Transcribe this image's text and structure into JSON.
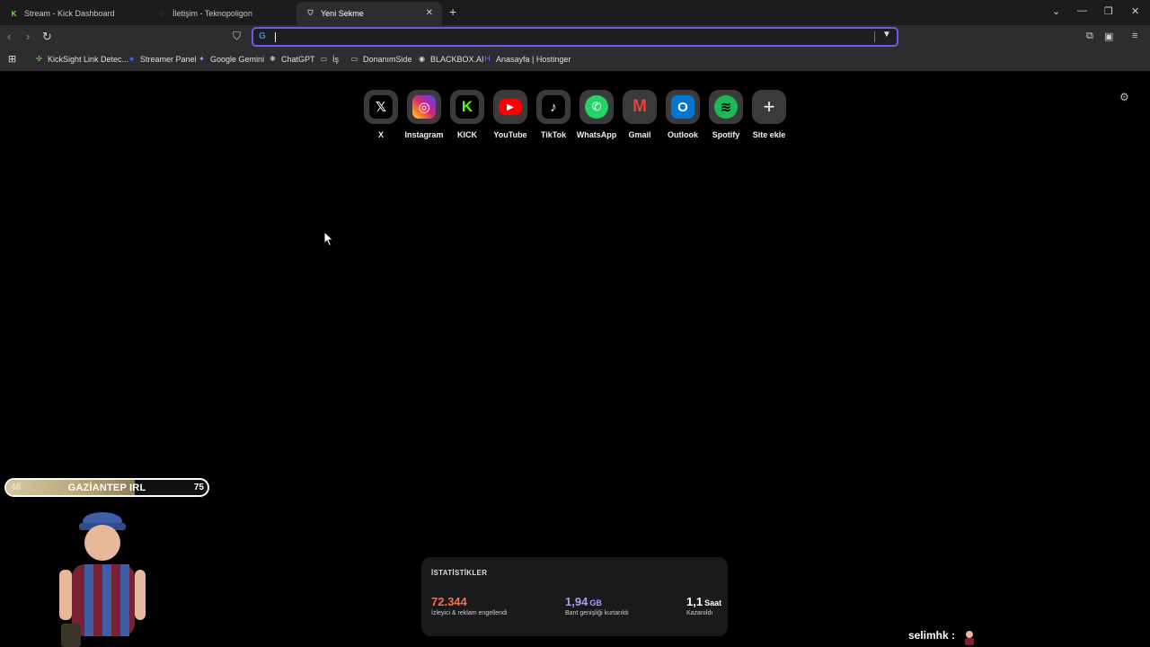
{
  "tabs": [
    {
      "title": "Stream - Kick Dashboard",
      "active": false
    },
    {
      "title": "İletişim - Teknopoligon",
      "active": false
    },
    {
      "title": "Yeni Sekme",
      "active": true
    }
  ],
  "toolbar": {
    "url_value": "",
    "search_engine_icon": "google-icon"
  },
  "bookmarks": [
    "KickSight Link Detec...",
    "Streamer Panel",
    "Google Gemini",
    "ChatGPT",
    "İş",
    "DonanımSide",
    "BLACKBOX.AI",
    "Anasayfa | Hostinger"
  ],
  "shortcuts": [
    {
      "label": "X",
      "color": "#000000",
      "glyph": "𝕏"
    },
    {
      "label": "Instagram",
      "color": "#d62976",
      "glyph": "◎"
    },
    {
      "label": "KICK",
      "color": "#53fc18",
      "glyph": "K"
    },
    {
      "label": "YouTube",
      "color": "#ff0000",
      "glyph": "▶"
    },
    {
      "label": "TikTok",
      "color": "#000000",
      "glyph": "♪"
    },
    {
      "label": "WhatsApp",
      "color": "#25d366",
      "glyph": "✆"
    },
    {
      "label": "Gmail",
      "color": "#ea4335",
      "glyph": "M"
    },
    {
      "label": "Outlook",
      "color": "#0078d4",
      "glyph": "O"
    },
    {
      "label": "Spotify",
      "color": "#1db954",
      "glyph": "≋"
    },
    {
      "label": "Site ekle",
      "color": "#3b3b3d",
      "glyph": "+"
    }
  ],
  "overlay": {
    "left_number": "48",
    "title": "GAZİANTEP IRL",
    "right_number": "75",
    "progress": 0.64
  },
  "stats": {
    "heading": "İSTATİSTİKLER",
    "items": [
      {
        "value": "72.344",
        "unit": "",
        "desc": "İzleyici & reklam engellendi",
        "color": "#ff6b4a"
      },
      {
        "value": "1,94",
        "unit": "GB",
        "desc": "Bant genişliği kurtarıldı",
        "color": "#a99bff"
      },
      {
        "value": "1,1",
        "unit": "Saat",
        "desc": "Kazanıldı",
        "color": "#ffffff"
      }
    ]
  },
  "chat_user": "selimhk :"
}
